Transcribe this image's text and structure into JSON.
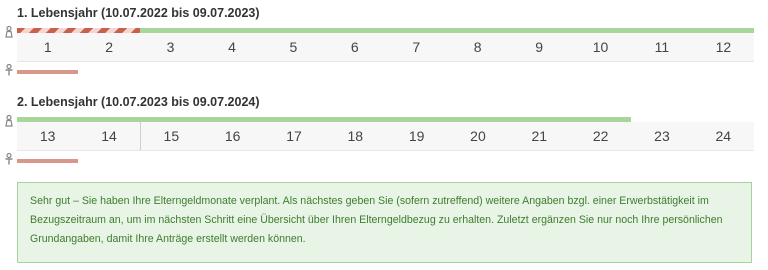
{
  "years": [
    {
      "title": "1. Lebensjahr (10.07.2022 bis 09.07.2023)",
      "months": [
        "1",
        "2",
        "3",
        "4",
        "5",
        "6",
        "7",
        "8",
        "9",
        "10",
        "11",
        "12"
      ]
    },
    {
      "title": "2. Lebensjahr (10.07.2023 bis 09.07.2024)",
      "months": [
        "13",
        "14",
        "15",
        "16",
        "17",
        "18",
        "19",
        "20",
        "21",
        "22",
        "23",
        "24"
      ]
    }
  ],
  "legend_icons": {
    "mother": "mother-icon",
    "father": "father-icon"
  },
  "colors": {
    "mother_bar": "#a8d69a",
    "father_bar": "#d9968a",
    "stripe_red": "#c8604a",
    "notice_bg": "#e8f4e5",
    "notice_text": "#3d7d2f"
  },
  "notice": "Sehr gut – Sie haben Ihre Elterngeldmonate verplant. Als nächstes geben Sie (sofern zutreffend) weitere Angaben bzgl. einer Erwerbstätigkeit im Bezugszeitraum an, um im nächsten Schritt eine Übersicht über Ihren Elterngeldbezug zu erhalten. Zuletzt ergänzen Sie nur noch Ihre persönlichen Grundangaben, damit Ihre Anträge erstellt werden können."
}
